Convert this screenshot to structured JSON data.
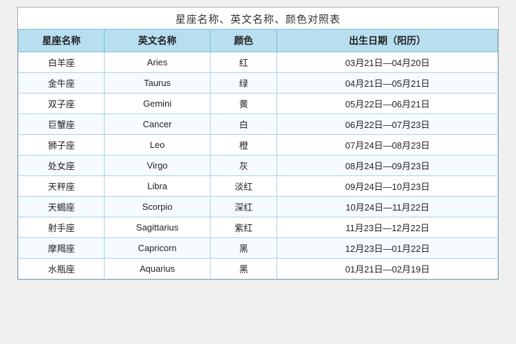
{
  "title": "星座名称、英文名称、颜色对照表",
  "headers": [
    "星座名称",
    "英文名称",
    "颜色",
    "出生日期（阳历）"
  ],
  "rows": [
    {
      "name": "白羊座",
      "en": "Aries",
      "color": "红",
      "date": "03月21日—04月20日"
    },
    {
      "name": "金牛座",
      "en": "Taurus",
      "color": "绿",
      "date": "04月21日—05月21日"
    },
    {
      "name": "双子座",
      "en": "Gemini",
      "color": "黄",
      "date": "05月22日—06月21日"
    },
    {
      "name": "巨蟹座",
      "en": "Cancer",
      "color": "白",
      "date": "06月22日—07月23日"
    },
    {
      "name": "狮子座",
      "en": "Leo",
      "color": "橙",
      "date": "07月24日—08月23日"
    },
    {
      "name": "处女座",
      "en": "Virgo",
      "color": "灰",
      "date": "08月24日—09月23日"
    },
    {
      "name": "天秤座",
      "en": "Libra",
      "color": "淡红",
      "date": "09月24日—10月23日"
    },
    {
      "name": "天蝎座",
      "en": "Scorpio",
      "color": "深红",
      "date": "10月24日—11月22日"
    },
    {
      "name": "射手座",
      "en": "Sagittarius",
      "color": "紫红",
      "date": "11月23日—12月22日"
    },
    {
      "name": "摩羯座",
      "en": "Capricorn",
      "color": "黑",
      "date": "12月23日—01月22日"
    },
    {
      "name": "水瓶座",
      "en": "Aquarius",
      "color": "黑",
      "date": "01月21日—02月19日"
    }
  ]
}
